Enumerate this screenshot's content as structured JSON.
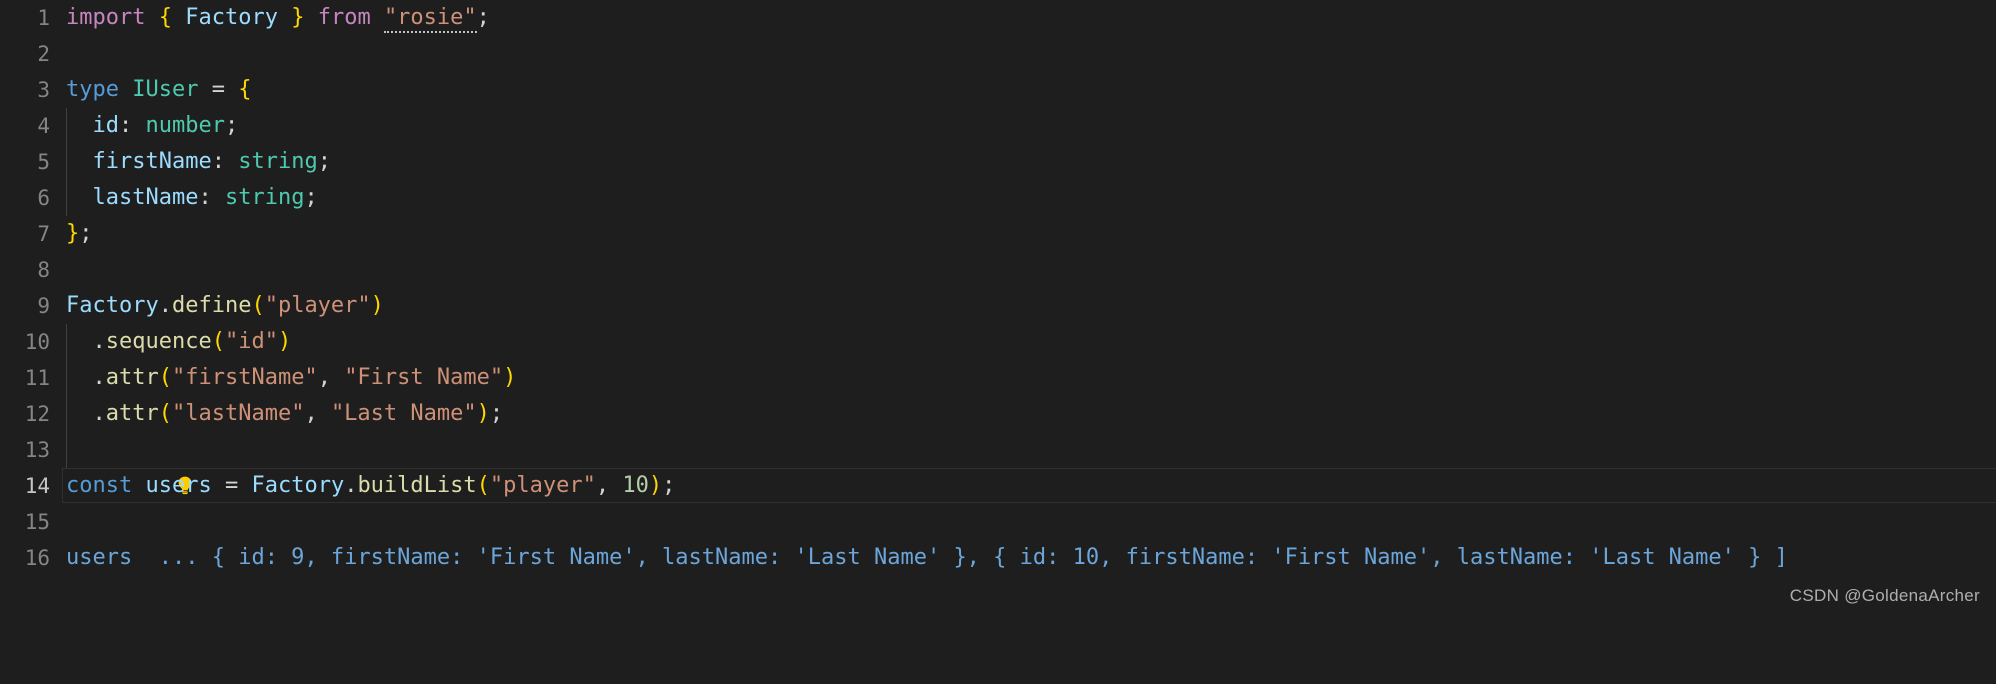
{
  "editor": {
    "background": "#1e1e1e",
    "gutter_color": "#858585",
    "active_gutter_color": "#c6c6c6",
    "active_line": 14,
    "language": "typescript"
  },
  "lines": [
    {
      "n": "1",
      "text": "import { Factory } from \"rosie\";"
    },
    {
      "n": "2",
      "text": ""
    },
    {
      "n": "3",
      "text": "type IUser = {"
    },
    {
      "n": "4",
      "text": "  id: number;"
    },
    {
      "n": "5",
      "text": "  firstName: string;"
    },
    {
      "n": "6",
      "text": "  lastName: string;"
    },
    {
      "n": "7",
      "text": "};"
    },
    {
      "n": "8",
      "text": ""
    },
    {
      "n": "9",
      "text": "Factory.define(\"player\")"
    },
    {
      "n": "10",
      "text": "  .sequence(\"id\")"
    },
    {
      "n": "11",
      "text": "  .attr(\"firstName\", \"First Name\")"
    },
    {
      "n": "12",
      "text": "  .attr(\"lastName\", \"Last Name\");"
    },
    {
      "n": "13",
      "text": "  "
    },
    {
      "n": "14",
      "text": "const users = Factory.buildList(\"player\", 10);"
    },
    {
      "n": "15",
      "text": ""
    },
    {
      "n": "16",
      "text": "users  ... { id: 9, firstName: 'First Name', lastName: 'Last Name' }, { id: 10, firstName: 'First Name', lastName: 'Last Name' } ]"
    }
  ],
  "tokens": {
    "l1": {
      "import": "import",
      "brace_open": "{",
      "factory": "Factory",
      "brace_close": "}",
      "from": "from",
      "module": "\"rosie\"",
      "semi": ";"
    },
    "l3": {
      "type_kw": "type",
      "name": "IUser",
      "eq": "=",
      "brace": "{"
    },
    "l4": {
      "prop": "id",
      "colon": ":",
      "type": "number",
      "semi": ";"
    },
    "l5": {
      "prop": "firstName",
      "colon": ":",
      "type": "string",
      "semi": ";"
    },
    "l6": {
      "prop": "lastName",
      "colon": ":",
      "type": "string",
      "semi": ";"
    },
    "l7": {
      "brace": "}",
      "semi": ";"
    },
    "l9": {
      "obj": "Factory",
      "dot": ".",
      "method": "define",
      "paren_open": "(",
      "arg": "\"player\"",
      "paren_close": ")"
    },
    "l10": {
      "dot": ".",
      "method": "sequence",
      "paren_open": "(",
      "arg": "\"id\"",
      "paren_close": ")"
    },
    "l11": {
      "dot": ".",
      "method": "attr",
      "paren_open": "(",
      "arg1": "\"firstName\"",
      "comma": ",",
      "arg2": "\"First Name\"",
      "paren_close": ")"
    },
    "l12": {
      "dot": ".",
      "method": "attr",
      "paren_open": "(",
      "arg1": "\"lastName\"",
      "comma": ",",
      "arg2": "\"Last Name\"",
      "paren_close": ")",
      "semi": ";"
    },
    "l14": {
      "const": "const",
      "var": "users",
      "eq": "=",
      "obj": "Factory",
      "dot": ".",
      "method": "buildList",
      "paren_open": "(",
      "arg1": "\"player\"",
      "comma": ",",
      "arg2": "10",
      "paren_close": ")",
      "semi": ";"
    },
    "l16": {
      "var": "users",
      "value": "... { id: 9, firstName: 'First Name', lastName: 'Last Name' }, { id: 10, firstName: 'First Name', lastName: 'Last Name' } ]"
    }
  },
  "icons": {
    "lightbulb": {
      "name": "lightbulb-quickfix-icon",
      "line": "13",
      "color": "#ffcc00"
    }
  },
  "watermark": {
    "text": "CSDN @GoldenaArcher"
  },
  "colors": {
    "keyword_blue": "#569cd6",
    "keyword_purple": "#c586c0",
    "type_green": "#4ec9b0",
    "class_blue": "#9cdcfe",
    "function_yellow": "#dcdcaa",
    "string_salmon": "#ce9178",
    "number_green": "#b5cea8",
    "punct_gray": "#d4d4d4",
    "bracket_yellow": "#ffd700",
    "inline_value_blue": "#6ca5d9"
  }
}
